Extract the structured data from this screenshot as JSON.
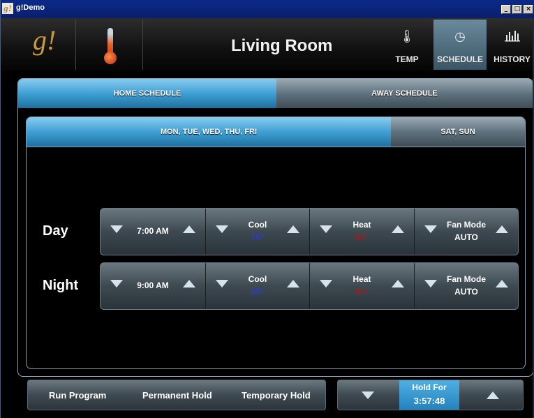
{
  "window": {
    "title": "g!Demo",
    "app_icon": "g!",
    "controls": [
      "minimize-icon",
      "maximize-icon",
      "close-icon"
    ]
  },
  "header": {
    "logo": "g!",
    "room_title": "Living Room",
    "nav": [
      {
        "label": "TEMP",
        "icon": "thermometer-icon"
      },
      {
        "label": "SCHEDULE",
        "icon": "clock-icon"
      },
      {
        "label": "HISTORY",
        "icon": "bar-chart-icon"
      }
    ],
    "active_nav": "SCHEDULE"
  },
  "schedule_tabs": {
    "home": "HOME SCHEDULE",
    "away": "AWAY SCHEDULE",
    "active": "HOME SCHEDULE"
  },
  "day_tabs": {
    "weekdays": "MON, TUE, WED, THU, FRI",
    "weekend": "SAT, SUN",
    "active": "MON, TUE, WED, THU, FRI"
  },
  "rows": [
    {
      "label": "Day",
      "time": "7:00  AM",
      "cool_label": "Cool",
      "cool_value": "76°",
      "heat_label": "Heat",
      "heat_value": "68°",
      "fan_label": "Fan Mode",
      "fan_value": "AUTO"
    },
    {
      "label": "Night",
      "time": "9:00  AM",
      "cool_label": "Cool",
      "cool_value": "85°",
      "heat_label": "Heat",
      "heat_value": "60°",
      "fan_label": "Fan Mode",
      "fan_value": "AUTO"
    }
  ],
  "bottom_bar": {
    "run_program": "Run Program",
    "permanent_hold": "Permanent Hold",
    "temporary_hold": "Temporary Hold"
  },
  "hold": {
    "label": "Hold For",
    "time": "3:57:48"
  },
  "colors": {
    "accent_blue": "#3fa0d4",
    "cool": "#2838ff",
    "heat": "#c21010",
    "logo": "#c89a3a"
  }
}
